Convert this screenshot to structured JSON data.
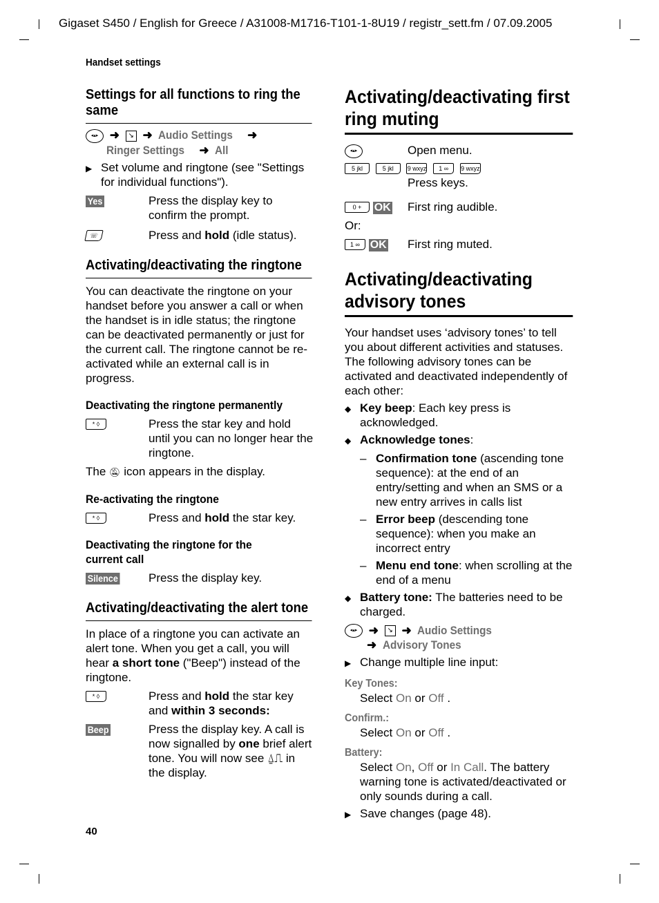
{
  "header": "Gigaset S450 / English for Greece / A31008-M1716-T101-1-8U19 / registr_sett.fm / 07.09.2005",
  "running_head": "Handset settings",
  "page_number": "40",
  "left": {
    "s1": {
      "title": "Settings for all functions to ring the same",
      "path": [
        "Audio Settings",
        "Ringer Settings",
        "All"
      ],
      "step": "Set volume and ringtone (see \"Settings for individual functions\").",
      "yes_key": "Yes",
      "yes_text": "Press the display key to confirm the prompt.",
      "end_pre": "Press and ",
      "end_bold": "hold",
      "end_post": " (idle status)."
    },
    "s2": {
      "title": "Activating/deactivating the ringtone",
      "intro": "You can deactivate the ringtone on your handset before you answer a call or when the handset is in idle status; the ringtone can be deactivated permanently or just for the current call. The ringtone cannot be re-activated while an external call is in progress.",
      "perm_title": "Deactivating the ringtone permanently",
      "perm_text": "Press the star key and hold until you can no longer hear the ringtone.",
      "icon_pre": "The ",
      "icon_post": " icon appears in the display.",
      "react_title": "Re-activating the ringtone",
      "react_pre": "Press and ",
      "react_bold": "hold",
      "react_post": " the star key.",
      "cur_title": "Deactivating the ringtone for the current call",
      "silence_key": "Silence",
      "silence_text": "Press the display key."
    },
    "s3": {
      "title": "Activating/deactivating the alert tone",
      "intro_pre": "In place of a ringtone you can activate an alert tone. When you get a call, you will hear ",
      "intro_bold": "a short tone",
      "intro_post": " (\"Beep\") instead of the ringtone.",
      "star_pre": "Press and ",
      "star_b1": "hold",
      "star_mid": " the star key and ",
      "star_b2": "within 3 seconds:",
      "beep_key": "Beep",
      "beep_pre": "Press the display key. A call is now signalled by ",
      "beep_bold": "one",
      "beep_post": " brief alert tone. You will now see ",
      "beep_end": " in the display."
    }
  },
  "right": {
    "s1": {
      "title": "Activating/deactivating first ring muting",
      "open_menu": "Open menu.",
      "keys": [
        "5 jkl",
        "5 jkl",
        "9 wxyz",
        "1 ∞",
        "9 wxyz"
      ],
      "press_keys": "Press keys.",
      "key0": "0 +",
      "ok": "OK",
      "audible": "First ring audible.",
      "or": "Or:",
      "key1": "1 ∞",
      "muted": "First ring muted."
    },
    "s2": {
      "title": "Activating/deactivating advisory tones",
      "intro": "Your handset uses ‘advisory tones’ to tell you about different activities and statuses. The following advisory tones can be activated and deactivated independently of each other:",
      "b1_bold": "Key beep",
      "b1_text": ": Each key press is acknowledged.",
      "b2_bold": "Acknowledge tones",
      "b2_text": ":",
      "d1_bold": "Confirmation tone",
      "d1_text": " (ascending tone sequence): at the end of an entry/setting and when an SMS or a new entry arrives in calls list",
      "d2_bold": "Error beep",
      "d2_text": " (descending tone sequence): when you make an incorrect entry",
      "d3_bold": "Menu end tone",
      "d3_text": ": when scrolling at the end of a menu",
      "b3_bold": "Battery tone:",
      "b3_text": " The batteries need to be charged.",
      "path": [
        "Audio Settings",
        "Advisory Tones"
      ],
      "change": "Change multiple line input:",
      "key_tones_label": "Key Tones:",
      "confirm_label": "Confirm.:",
      "battery_label": "Battery:",
      "select": "Select ",
      "on": "On",
      "or": " or ",
      "off": "Off",
      "in_call": "In Call",
      "battery_post": ". The battery warning tone is activated/deactivated or only sounds during a call.",
      "save": "Save changes (page 48)."
    }
  }
}
